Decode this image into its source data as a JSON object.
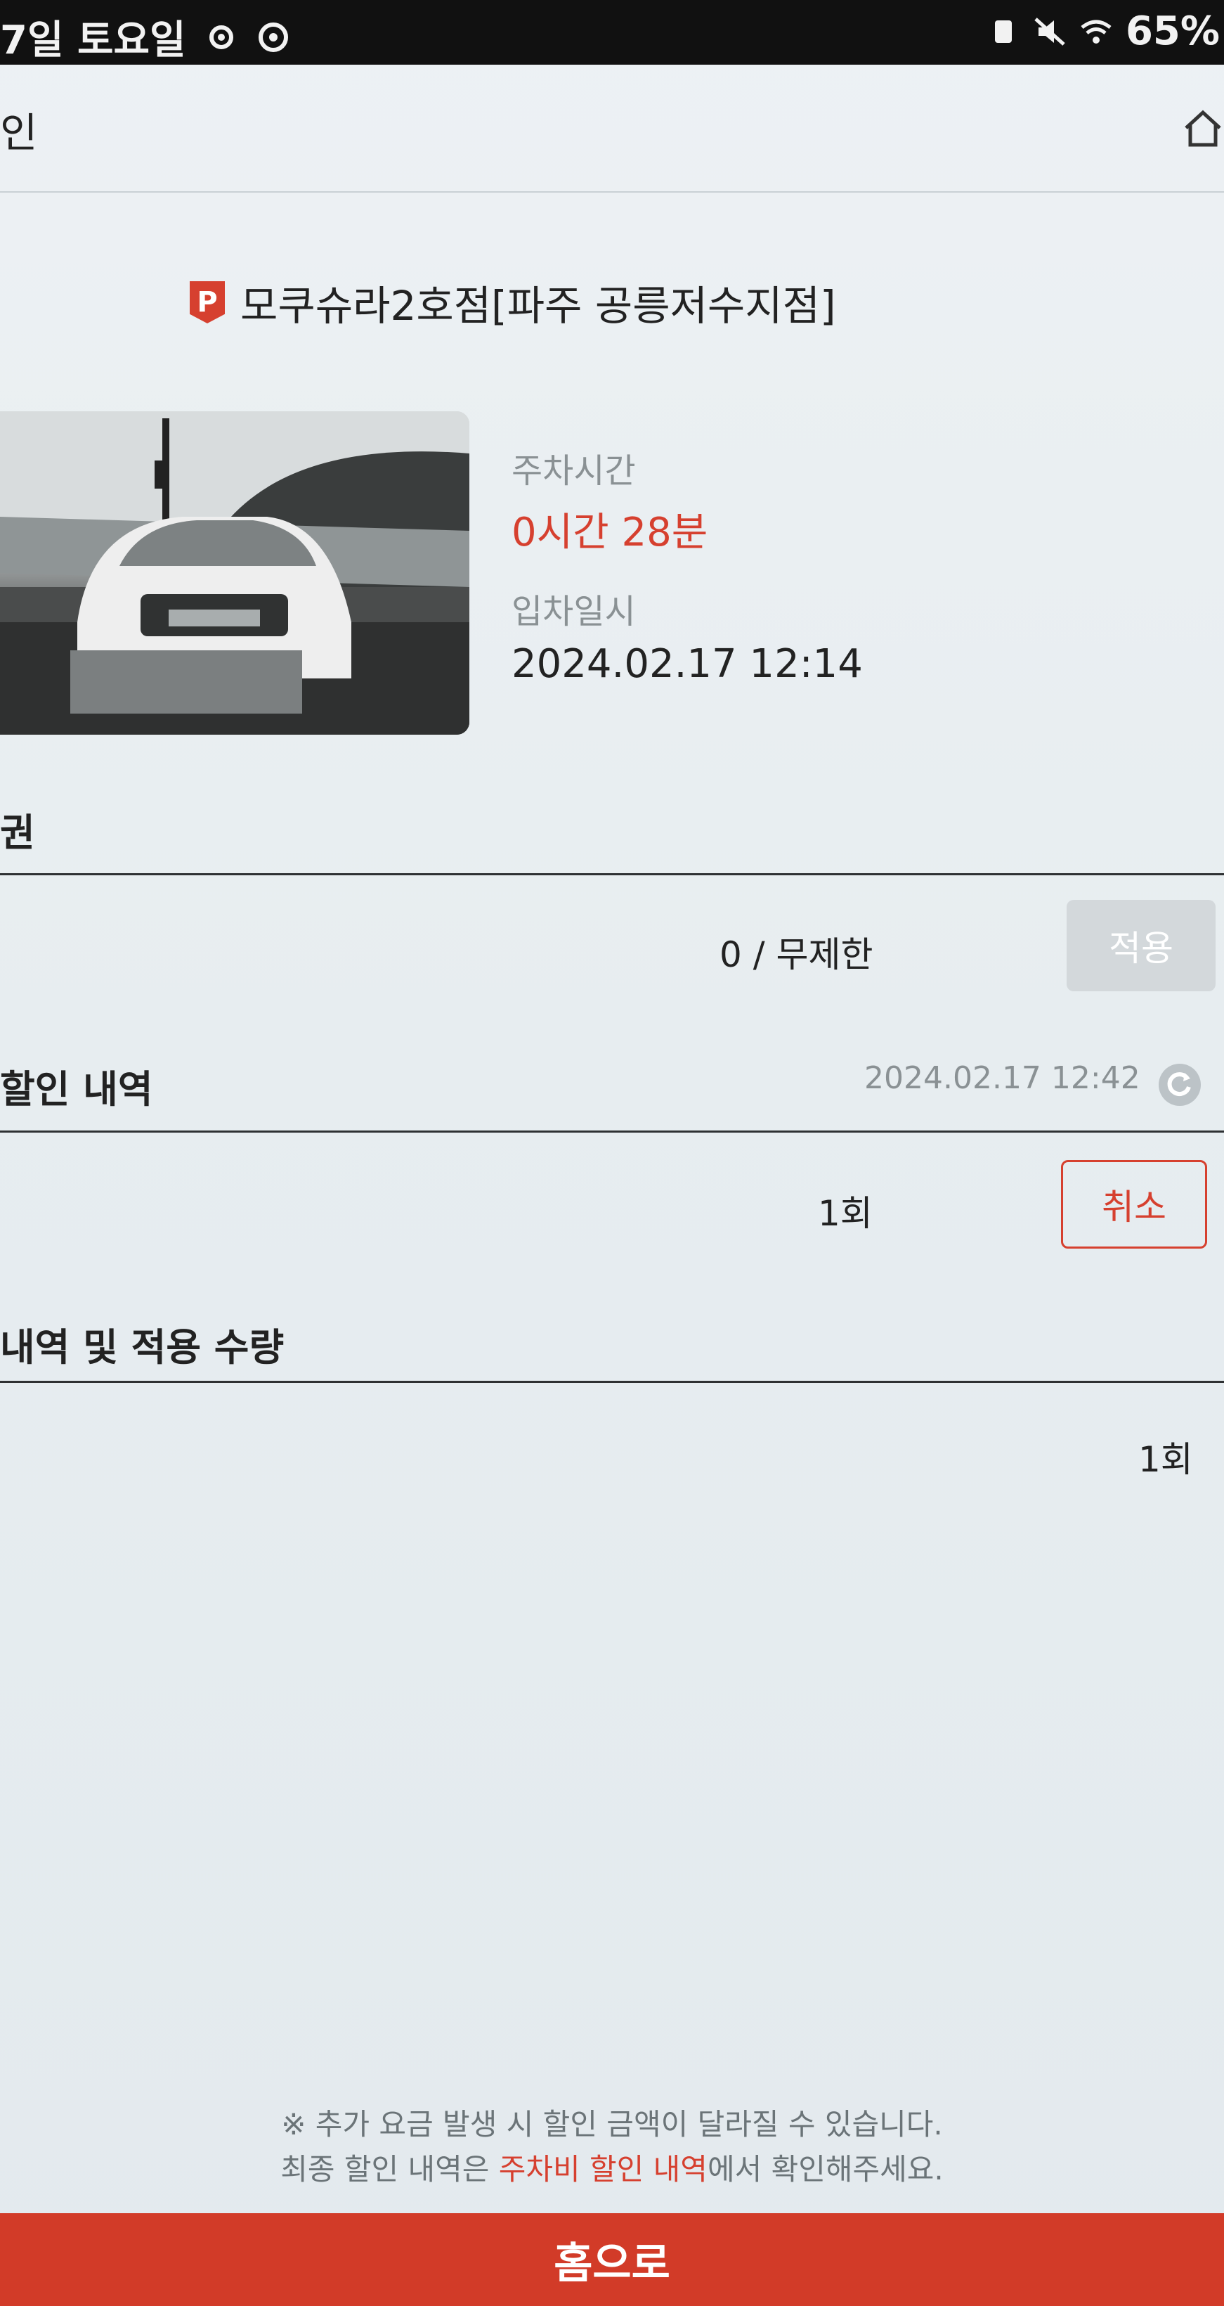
{
  "status_bar": {
    "date_text": "7일 토요일",
    "battery": "65%"
  },
  "header": {
    "title": "인"
  },
  "store": {
    "badge": "P",
    "name": "모쿠슈라2호점[파주 공릉저수지점]"
  },
  "parking": {
    "duration_label": "주차시간",
    "duration_value": "0시간 28분",
    "entry_label": "입차일시",
    "entry_value": "2024.02.17 12:14"
  },
  "discount": {
    "section_label": "권",
    "usage": "0 / 무제한",
    "apply_label": "적용"
  },
  "history": {
    "title": "할인 내역",
    "timestamp": "2024.02.17 12:42",
    "count": "1회",
    "cancel_label": "취소"
  },
  "summary": {
    "title": "내역 및 적용 수량",
    "count": "1회"
  },
  "notice": {
    "line1": "※ 추가 요금 발생 시 할인 금액이 달라질 수 있습니다.",
    "line2_prefix": "최종 할인 내역은 ",
    "line2_link": "주차비 할인 내역",
    "line2_suffix": "에서 확인해주세요."
  },
  "footer": {
    "home_label": "홈으로"
  },
  "colors": {
    "accent_red": "#d6402f",
    "button_disabled": "#d3d8db"
  }
}
